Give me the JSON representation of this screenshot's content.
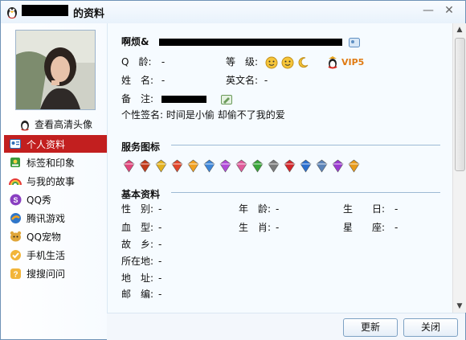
{
  "window": {
    "title_suffix": "的资料",
    "minimize": "—",
    "close": "✕"
  },
  "sidebar": {
    "hd_link": "查看高清头像",
    "items": [
      {
        "label": "个人资料",
        "icon": "profile-card-icon",
        "color": "#2e6db8",
        "active": true
      },
      {
        "label": "标签和印象",
        "icon": "tag-icon",
        "color": "#2d8c2d"
      },
      {
        "label": "与我的故事",
        "icon": "rainbow-icon",
        "color": "#e07a1a"
      },
      {
        "label": "QQ秀",
        "icon": "qq-show-icon",
        "color": "#8a3fc1"
      },
      {
        "label": "腾讯游戏",
        "icon": "game-icon",
        "color": "#2f76c9"
      },
      {
        "label": "QQ宠物",
        "icon": "pet-icon",
        "color": "#c98a1c"
      },
      {
        "label": "手机生活",
        "icon": "mobile-check-icon",
        "color": "#e6a018"
      },
      {
        "label": "搜搜问问",
        "icon": "question-icon",
        "color": "#e6a018"
      }
    ]
  },
  "profile": {
    "nickname_prefix": "啊烦&",
    "qq_age_label": "Q　龄:",
    "qq_age_value": "-",
    "level_label": "等　级:",
    "vip_label": "VIP5",
    "name_label": "姓　名:",
    "name_value": "-",
    "english_name_label": "英文名:",
    "english_name_value": "-",
    "remark_label": "备　注:",
    "signature_label": "个性签名:",
    "signature_value": "时间是小偷 却偷不了我的爱"
  },
  "services_section": {
    "title": "服务图标",
    "icons": [
      {
        "name": "heart-icon",
        "color": "#e0457b"
      },
      {
        "name": "penguin-icon",
        "color": "#c23a1a"
      },
      {
        "name": "diamond-yellow-icon",
        "color": "#e3b21f"
      },
      {
        "name": "diamond-red-icon",
        "color": "#e0452a"
      },
      {
        "name": "diamond-gold-icon",
        "color": "#f0a020"
      },
      {
        "name": "diamond-blue-icon",
        "color": "#3d86d8"
      },
      {
        "name": "diamond-purple-icon",
        "color": "#b04ad8"
      },
      {
        "name": "diamond-pink-icon",
        "color": "#e05a9a"
      },
      {
        "name": "diamond-green-icon",
        "color": "#3aa53a"
      },
      {
        "name": "diamond-gray-icon",
        "color": "#7a7a7a"
      },
      {
        "name": "badge-red-icon",
        "color": "#d2272b"
      },
      {
        "name": "phone-blue-icon",
        "color": "#2a6fcf"
      },
      {
        "name": "phone-gray-icon",
        "color": "#5a83b8"
      },
      {
        "name": "music-icon",
        "color": "#9a3ad0"
      },
      {
        "name": "book-icon",
        "color": "#e79a1a"
      }
    ]
  },
  "basic_section": {
    "title": "基本资料",
    "fields": {
      "gender": {
        "label": "性　别:",
        "value": "-"
      },
      "age": {
        "label": "年　龄:",
        "value": "-"
      },
      "birthday": {
        "label": "生　　日:",
        "value": "-"
      },
      "blood": {
        "label": "血　型:",
        "value": "-"
      },
      "zodiac": {
        "label": "生　肖:",
        "value": "-"
      },
      "constellation": {
        "label": "星　　座:",
        "value": "-"
      },
      "hometown": {
        "label": "故　乡:",
        "value": "-"
      },
      "location": {
        "label": "所在地:",
        "value": "-"
      },
      "address": {
        "label": "地　址:",
        "value": "-"
      },
      "postcode": {
        "label": "邮　编:",
        "value": "-"
      }
    }
  },
  "footer": {
    "refresh": "更新",
    "close": "关闭"
  }
}
